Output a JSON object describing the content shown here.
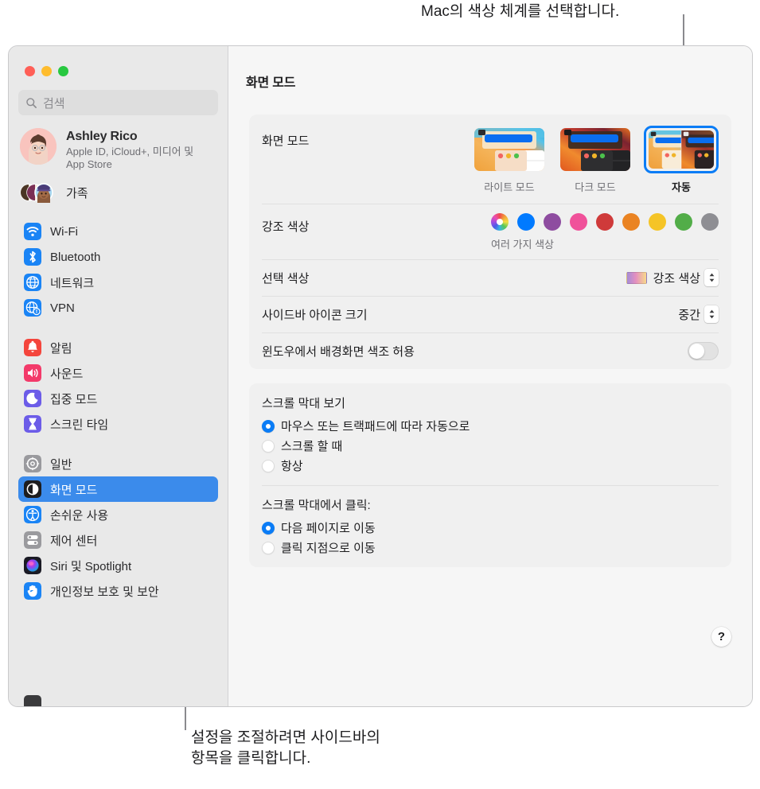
{
  "callouts": {
    "top": "Mac의 색상 체계를 선택합니다.",
    "bottom": "설정을 조절하려면 사이드바의\n항목을 클릭합니다."
  },
  "window": {
    "title": "화면 모드"
  },
  "sidebar": {
    "search": {
      "placeholder": "검색"
    },
    "account": {
      "name": "Ashley Rico",
      "subtitle": "Apple ID, iCloud+, 미디어 및 App Store"
    },
    "family": {
      "label": "가족"
    },
    "groups": [
      {
        "items": [
          {
            "label": "Wi-Fi",
            "icon": "wifi-icon",
            "color": "#1a84f5"
          },
          {
            "label": "Bluetooth",
            "icon": "bluetooth-icon",
            "color": "#1a84f5"
          },
          {
            "label": "네트워크",
            "icon": "globe-icon",
            "color": "#1a84f5"
          },
          {
            "label": "VPN",
            "icon": "vpn-globe-icon",
            "color": "#1a84f5"
          }
        ]
      },
      {
        "items": [
          {
            "label": "알림",
            "icon": "bell-icon",
            "color": "#f4453c"
          },
          {
            "label": "사운드",
            "icon": "speaker-icon",
            "color": "#f33a6a"
          },
          {
            "label": "집중 모드",
            "icon": "moon-icon",
            "color": "#6c5ce8"
          },
          {
            "label": "스크린 타임",
            "icon": "hourglass-icon",
            "color": "#6c5ce8"
          }
        ]
      },
      {
        "items": [
          {
            "label": "일반",
            "icon": "gear-icon",
            "color": "#9a9a9e"
          },
          {
            "label": "화면 모드",
            "icon": "appearance-icon",
            "color": "#1d1d1f",
            "selected": true
          },
          {
            "label": "손쉬운 사용",
            "icon": "accessibility-icon",
            "color": "#1a84f5"
          },
          {
            "label": "제어 센터",
            "icon": "control-center-icon",
            "color": "#9a9a9e"
          },
          {
            "label": "Siri 및 Spotlight",
            "icon": "siri-icon",
            "color": "#2a2a3e"
          },
          {
            "label": "개인정보 보호 및 보안",
            "icon": "privacy-hand-icon",
            "color": "#1a84f5"
          }
        ]
      }
    ]
  },
  "main": {
    "appearance_card": {
      "mode_row": {
        "label": "화면 모드",
        "options": [
          {
            "caption": "라이트 모드",
            "value": "light",
            "selected": false
          },
          {
            "caption": "다크 모드",
            "value": "dark",
            "selected": false
          },
          {
            "caption": "자동",
            "value": "auto",
            "selected": true
          }
        ]
      },
      "accent_row": {
        "label": "강조 색상",
        "sublabel": "여러 가지 색상",
        "colors": [
          {
            "name": "multicolor",
            "hex": "multicolor",
            "selected": true
          },
          {
            "name": "blue",
            "hex": "#007aff"
          },
          {
            "name": "purple",
            "hex": "#8e4ca0"
          },
          {
            "name": "pink",
            "hex": "#f0519a"
          },
          {
            "name": "red",
            "hex": "#cf3a3a"
          },
          {
            "name": "orange",
            "hex": "#ea8322"
          },
          {
            "name": "yellow",
            "hex": "#f5c426"
          },
          {
            "name": "green",
            "hex": "#52ad48"
          },
          {
            "name": "graphite",
            "hex": "#8e8e93"
          }
        ]
      },
      "highlight_row": {
        "label": "선택 색상",
        "value": "강조 색상",
        "swatch": "gradient"
      },
      "sidebar_icon_row": {
        "label": "사이드바 아이콘 크기",
        "value": "중간"
      },
      "wallpaper_tint_row": {
        "label": "윈도우에서 배경화면 색조 허용",
        "toggle_on": false
      }
    },
    "scroll_card": {
      "show_scrollbars": {
        "title": "스크롤 막대 보기",
        "options": [
          {
            "label": "마우스 또는 트랙패드에 따라 자동으로",
            "selected": true
          },
          {
            "label": "스크롤 할 때",
            "selected": false
          },
          {
            "label": "항상",
            "selected": false
          }
        ]
      },
      "click_scrollbar": {
        "title": "스크롤 막대에서 클릭:",
        "options": [
          {
            "label": "다음 페이지로 이동",
            "selected": true
          },
          {
            "label": "클릭 지점으로 이동",
            "selected": false
          }
        ]
      }
    },
    "help_label": "?"
  }
}
